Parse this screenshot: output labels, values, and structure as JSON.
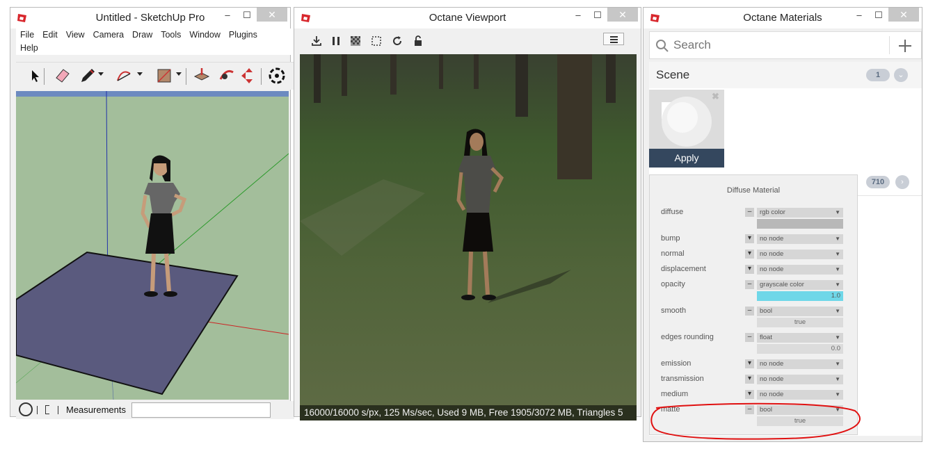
{
  "sketchup": {
    "title": "Untitled - SketchUp Pro",
    "menu": [
      "File",
      "Edit",
      "View",
      "Camera",
      "Draw",
      "Tools",
      "Window",
      "Plugins"
    ],
    "menu_line2": "Help",
    "measurements_label": "Measurements",
    "status_icons": [
      "question-circle-icon",
      "pipe-sep",
      "bracket-icon"
    ]
  },
  "viewport": {
    "title": "Octane Viewport",
    "status_text": "16000/16000 s/px, 125 Ms/sec, Used 9 MB, Free 1905/3072 MB, Triangles 5",
    "toolbar_icons": [
      "export-icon",
      "pause-icon",
      "checker-icon",
      "region-icon",
      "refresh-icon",
      "lock-icon"
    ],
    "menu_icon": "hamburger-icon"
  },
  "materials": {
    "title": "Octane Materials",
    "search_placeholder": "Search",
    "add_icon": "plus-icon",
    "scene_label": "Scene",
    "scene_count": "1",
    "apply_label": "Apply",
    "library_count": "710",
    "popup": {
      "heading": "Diffuse Material",
      "rows": [
        {
          "label": "diffuse",
          "control": "–",
          "select": "rgb color",
          "value": ""
        },
        {
          "label": "bump",
          "control": "▾",
          "select": "no node",
          "value": null
        },
        {
          "label": "normal",
          "control": "▾",
          "select": "no node",
          "value": null
        },
        {
          "label": "displacement",
          "control": "▾",
          "select": "no node",
          "value": null
        },
        {
          "label": "opacity",
          "control": "–",
          "select": "grayscale color",
          "value": "1.0"
        },
        {
          "label": "smooth",
          "control": "–",
          "select": "bool",
          "value": "true"
        },
        {
          "label": "edges rounding",
          "control": "–",
          "select": "float",
          "value": "0.0"
        },
        {
          "label": "emission",
          "control": "▾",
          "select": "no node",
          "value": null
        },
        {
          "label": "transmission",
          "control": "▾",
          "select": "no node",
          "value": null
        },
        {
          "label": "medium",
          "control": "▾",
          "select": "no node",
          "value": null
        },
        {
          "label": "matte",
          "control": "–",
          "select": "bool",
          "value": "true"
        }
      ]
    }
  },
  "colors": {
    "ground_green": "#a3be9b",
    "plane_blue": "#5a5a7e",
    "apply_bg": "#34475e",
    "opacity_bar": "#6fd7e8",
    "annotation_red": "#e01010"
  },
  "window_controls": {
    "minimize": "–",
    "maximize": "☐",
    "close": "✕"
  }
}
